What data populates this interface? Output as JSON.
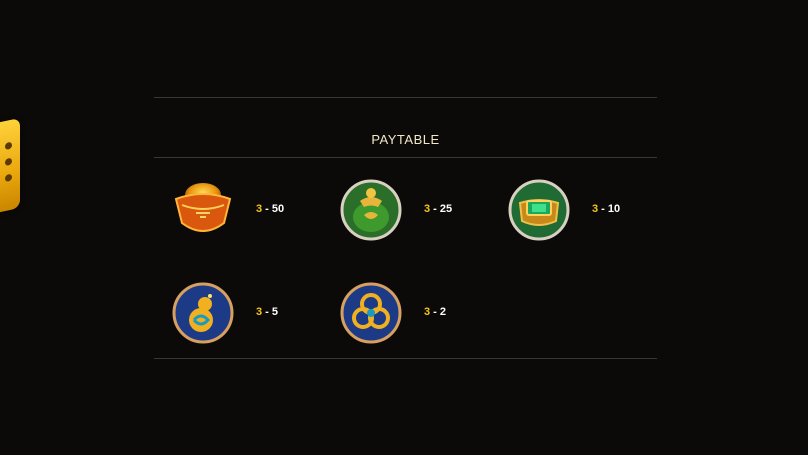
{
  "paytable": {
    "title": "PAYTABLE",
    "items": [
      {
        "icon": "gold-ingot-icon",
        "count": "3",
        "sep": " - ",
        "payout": "50"
      },
      {
        "icon": "money-bag-icon",
        "count": "3",
        "sep": " - ",
        "payout": "25"
      },
      {
        "icon": "jade-ring-icon",
        "count": "3",
        "sep": " - ",
        "payout": "10"
      },
      {
        "icon": "gourd-icon",
        "count": "3",
        "sep": " - ",
        "payout": "5"
      },
      {
        "icon": "knot-icon",
        "count": "3",
        "sep": " - ",
        "payout": "2"
      }
    ]
  },
  "colors": {
    "background": "#0b0a08",
    "accent": "#f5c518",
    "divider": "#3a3630",
    "title": "#f2e7c7"
  }
}
